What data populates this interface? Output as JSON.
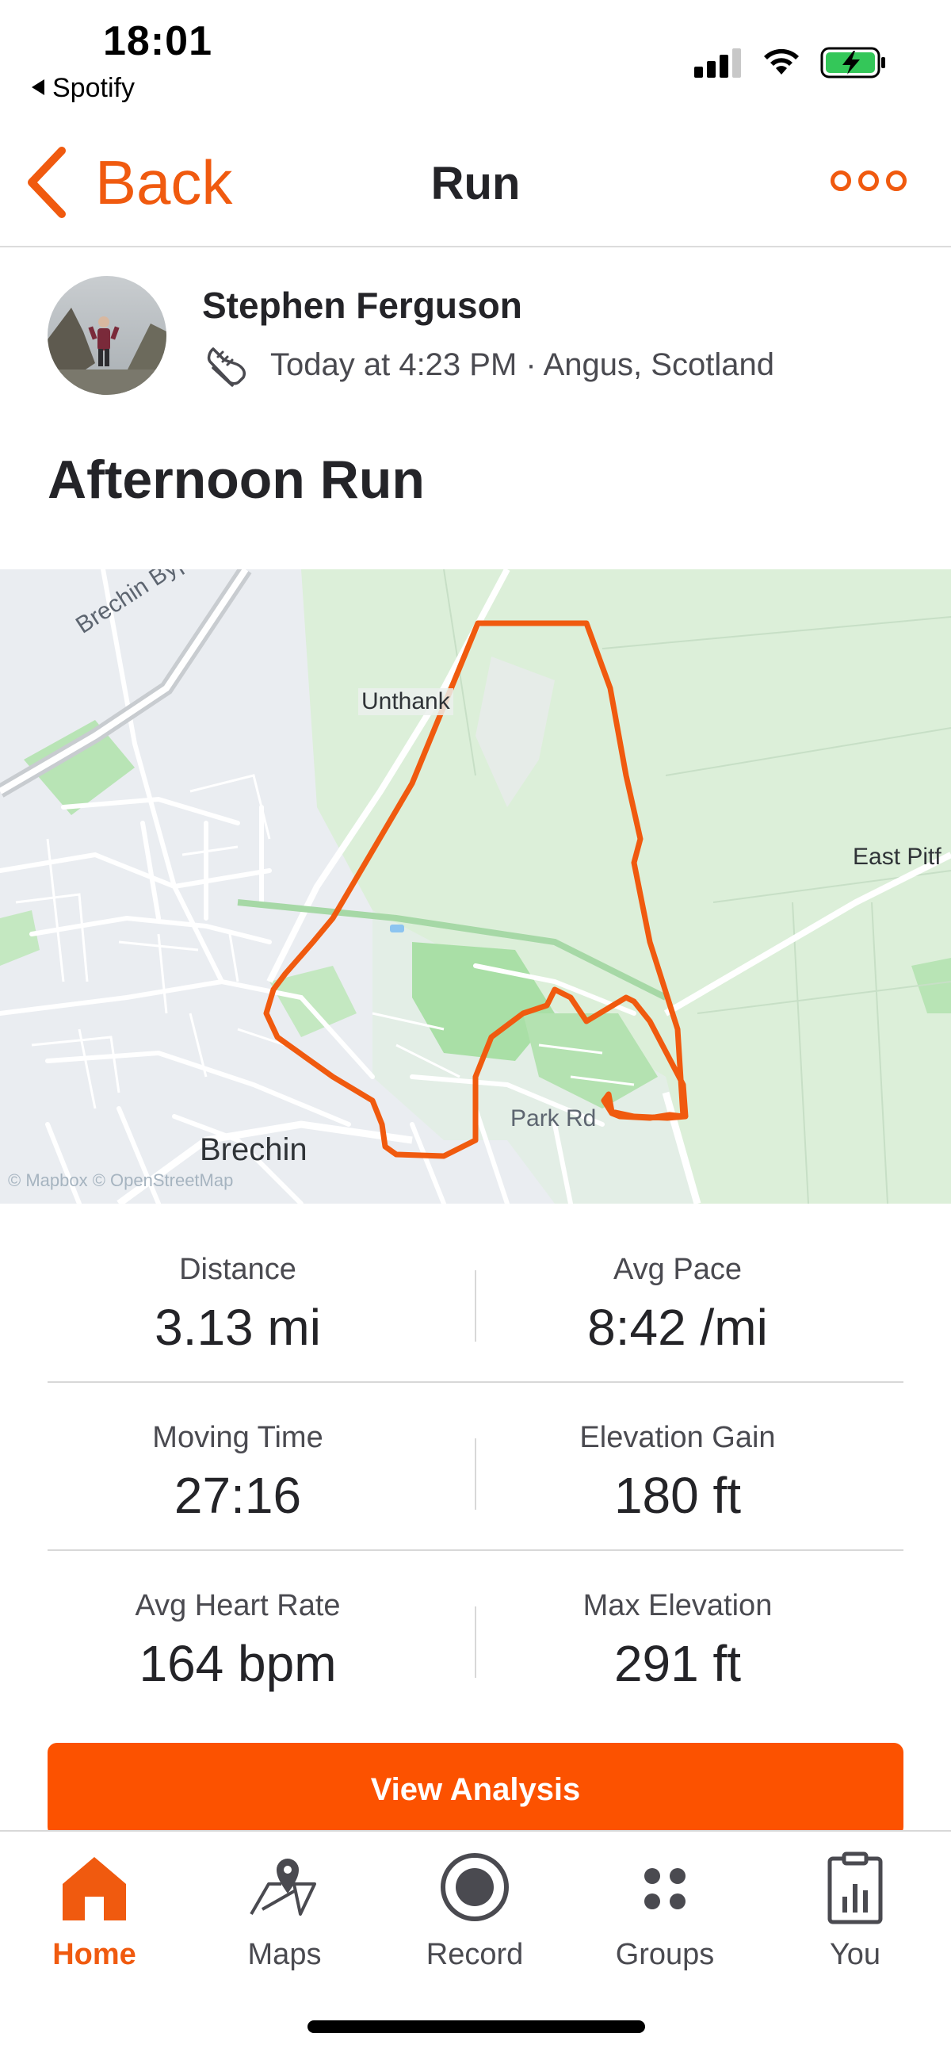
{
  "status_bar": {
    "time": "18:01",
    "back_app": "Spotify"
  },
  "nav": {
    "back_label": "Back",
    "title": "Run"
  },
  "athlete": {
    "name": "Stephen Ferguson",
    "meta": "Today at 4:23 PM · Angus, Scotland"
  },
  "activity": {
    "title": "Afternoon Run"
  },
  "map": {
    "labels": {
      "bypass": "Brechin Bypass",
      "unthank": "Unthank",
      "east": "East Pitf",
      "park_rd": "Park Rd",
      "brechin": "Brechin"
    },
    "attribution": "© Mapbox © OpenStreetMap",
    "route_color": "#f05a0f"
  },
  "stats": [
    {
      "left": {
        "label": "Distance",
        "value": "3.13 mi"
      },
      "right": {
        "label": "Avg Pace",
        "value": "8:42 /mi"
      }
    },
    {
      "left": {
        "label": "Moving Time",
        "value": "27:16"
      },
      "right": {
        "label": "Elevation Gain",
        "value": "180 ft"
      }
    },
    {
      "left": {
        "label": "Avg Heart Rate",
        "value": "164 bpm"
      },
      "right": {
        "label": "Max Elevation",
        "value": "291 ft"
      }
    }
  ],
  "view_analysis": "View Analysis",
  "tabs": [
    {
      "label": "Home",
      "icon": "home-icon",
      "active": true
    },
    {
      "label": "Maps",
      "icon": "maps-icon",
      "active": false
    },
    {
      "label": "Record",
      "icon": "record-icon",
      "active": false
    },
    {
      "label": "Groups",
      "icon": "groups-icon",
      "active": false
    },
    {
      "label": "You",
      "icon": "you-icon",
      "active": false
    }
  ],
  "colors": {
    "brand": "#fc5200",
    "accent": "#f05a0f"
  }
}
